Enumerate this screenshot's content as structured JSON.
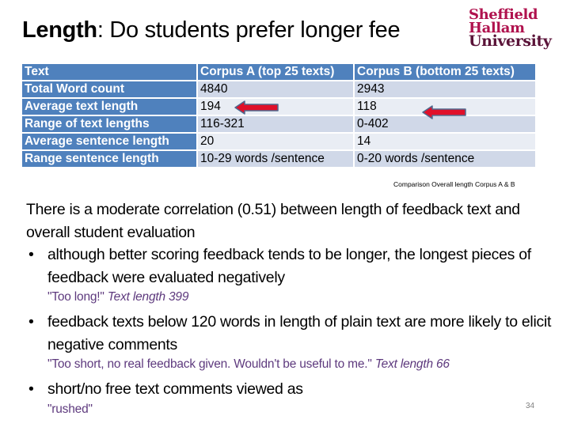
{
  "slide": {
    "title_bold": "Length",
    "title_rest": ": Do students prefer longer fee",
    "logo": {
      "line1": "Sheffield",
      "line2": "Hallam",
      "line3": "University"
    },
    "page_number": "34"
  },
  "table": {
    "headers": [
      "Text",
      "Corpus A (top 25 texts)",
      "Corpus B (bottom 25 texts)"
    ],
    "rows": [
      {
        "label": "Total Word count",
        "a": "4840",
        "b": "2943"
      },
      {
        "label": "Average text length",
        "a": "194",
        "b": "118"
      },
      {
        "label": "Range of text lengths",
        "a": "116-321",
        "b": "0-402"
      },
      {
        "label": "Average  sentence length",
        "a": "20",
        "b": "14"
      },
      {
        "label": "Range sentence length",
        "a": "10-29 words /sentence",
        "b": "0-20 words /sentence"
      }
    ],
    "caption": "Comparison Overall length Corpus A & B",
    "colors": {
      "header": "#4f81bd",
      "row_odd": "#d0d8e8",
      "row_even": "#e9edf4",
      "arrow": "#e0102a",
      "arrow_outline": "#4f6a8f"
    }
  },
  "body": {
    "intro": "There is a moderate correlation (0.51) between length of feedback text and overall student evaluation",
    "bullets": [
      {
        "text": "although better scoring feedback tends to be longer, the longest pieces of feedback were evaluated negatively",
        "quote": "\"Too long!\"",
        "quote_meta": "Text length 399"
      },
      {
        "text": "feedback texts below 120 words in length of plain text are more likely to elicit negative comments",
        "quote": "\"Too short, no real feedback given. Wouldn't be useful to me.\"",
        "quote_meta": "Text length 66"
      },
      {
        "text": "short/no free text comments viewed as",
        "quote": "\"rushed\"",
        "quote_meta": ""
      }
    ],
    "bullet_glyph": "•"
  }
}
